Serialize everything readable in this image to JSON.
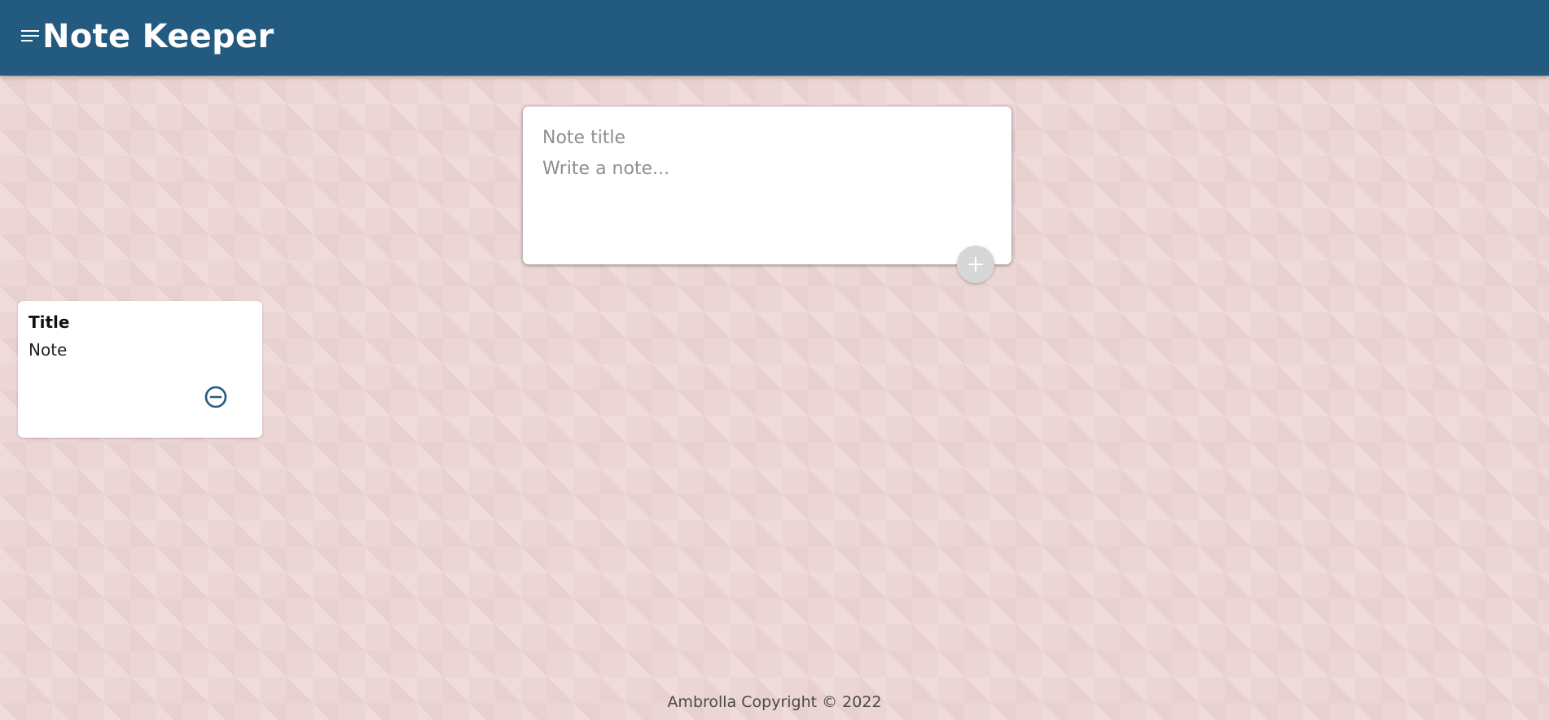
{
  "header": {
    "menu_icon": "menu-icon",
    "title": "Note Keeper"
  },
  "composer": {
    "title_placeholder": "Note title",
    "content_placeholder": "Write a note...",
    "add_icon": "plus-icon"
  },
  "notes": [
    {
      "title": "Title",
      "content": "Note",
      "delete_icon": "minus-circle-icon"
    }
  ],
  "footer": {
    "text": "Ambrolla Copyright © 2022"
  },
  "colors": {
    "header_background": "#235a80",
    "page_background": "#ecd6d5",
    "card_background": "#ffffff",
    "add_button_background": "#d7d7d7",
    "delete_icon": "#235a80"
  }
}
